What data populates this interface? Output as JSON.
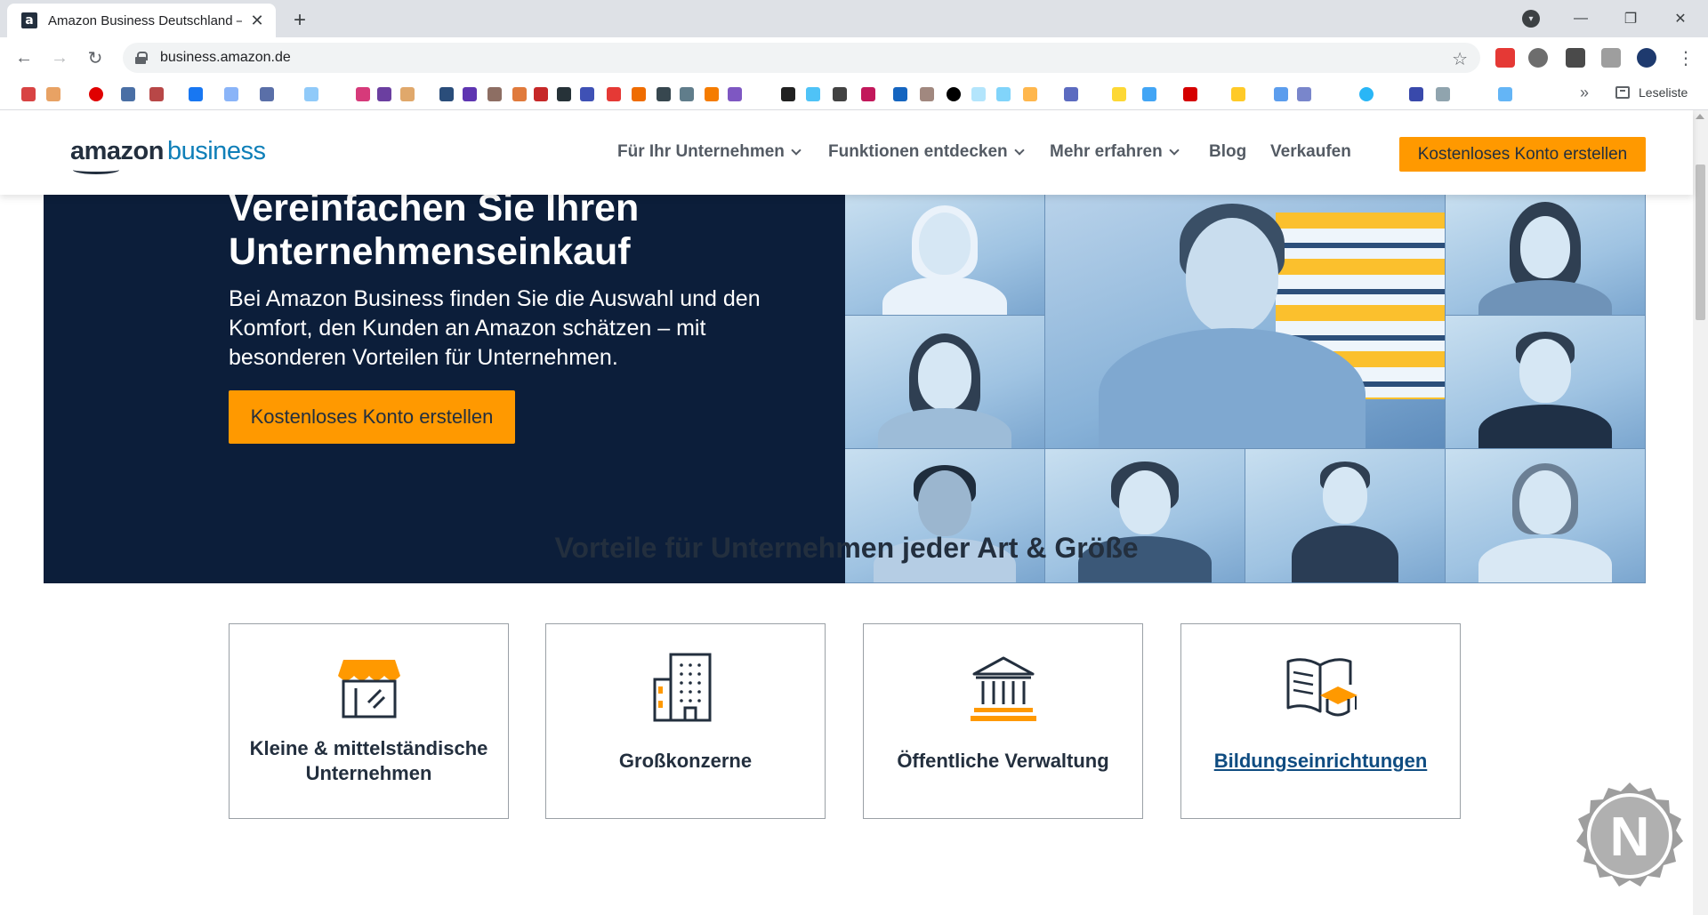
{
  "browser": {
    "tab_title": "Amazon Business Deutschland – …",
    "favicon_letter": "a",
    "url": "business.amazon.de",
    "reading_list_label": "Leseliste",
    "bookmarks_more": "»",
    "new_tab": "+",
    "close_tab": "✕"
  },
  "header": {
    "logo_amazon": "amazon",
    "logo_business": "business",
    "nav": [
      {
        "label": "Für Ihr Unternehmen",
        "has_dropdown": true
      },
      {
        "label": "Funktionen entdecken",
        "has_dropdown": true
      },
      {
        "label": "Mehr erfahren",
        "has_dropdown": true
      },
      {
        "label": "Blog",
        "has_dropdown": false
      },
      {
        "label": "Verkaufen",
        "has_dropdown": false
      }
    ],
    "cta_label": "Kostenloses Konto erstellen"
  },
  "hero": {
    "title": "Vereinfachen Sie Ihren Unternehmenseinkauf",
    "subtitle": "Bei Amazon Business finden Sie die Auswahl und den Komfort, den Kunden an Amazon schätzen – mit besonderen Vorteilen für Unternehmen.",
    "cta_label": "Kostenloses Konto erstellen"
  },
  "benefits": {
    "title": "Vorteile für Unternehmen jeder Art & Größe",
    "cards": [
      {
        "label": "Kleine & mittelständische Unternehmen",
        "icon": "storefront-icon",
        "is_link": false
      },
      {
        "label": "Großkonzerne",
        "icon": "office-building-icon",
        "is_link": false
      },
      {
        "label": "Öffentliche Verwaltung",
        "icon": "government-building-icon",
        "is_link": false
      },
      {
        "label": "Bildungseinrichtungen",
        "icon": "education-book-icon",
        "is_link": true
      }
    ]
  },
  "colors": {
    "accent_orange": "#ff9900",
    "hero_navy": "#0c1e3a",
    "logo_blue": "#0f7fb8",
    "text_dark": "#232f3e"
  }
}
